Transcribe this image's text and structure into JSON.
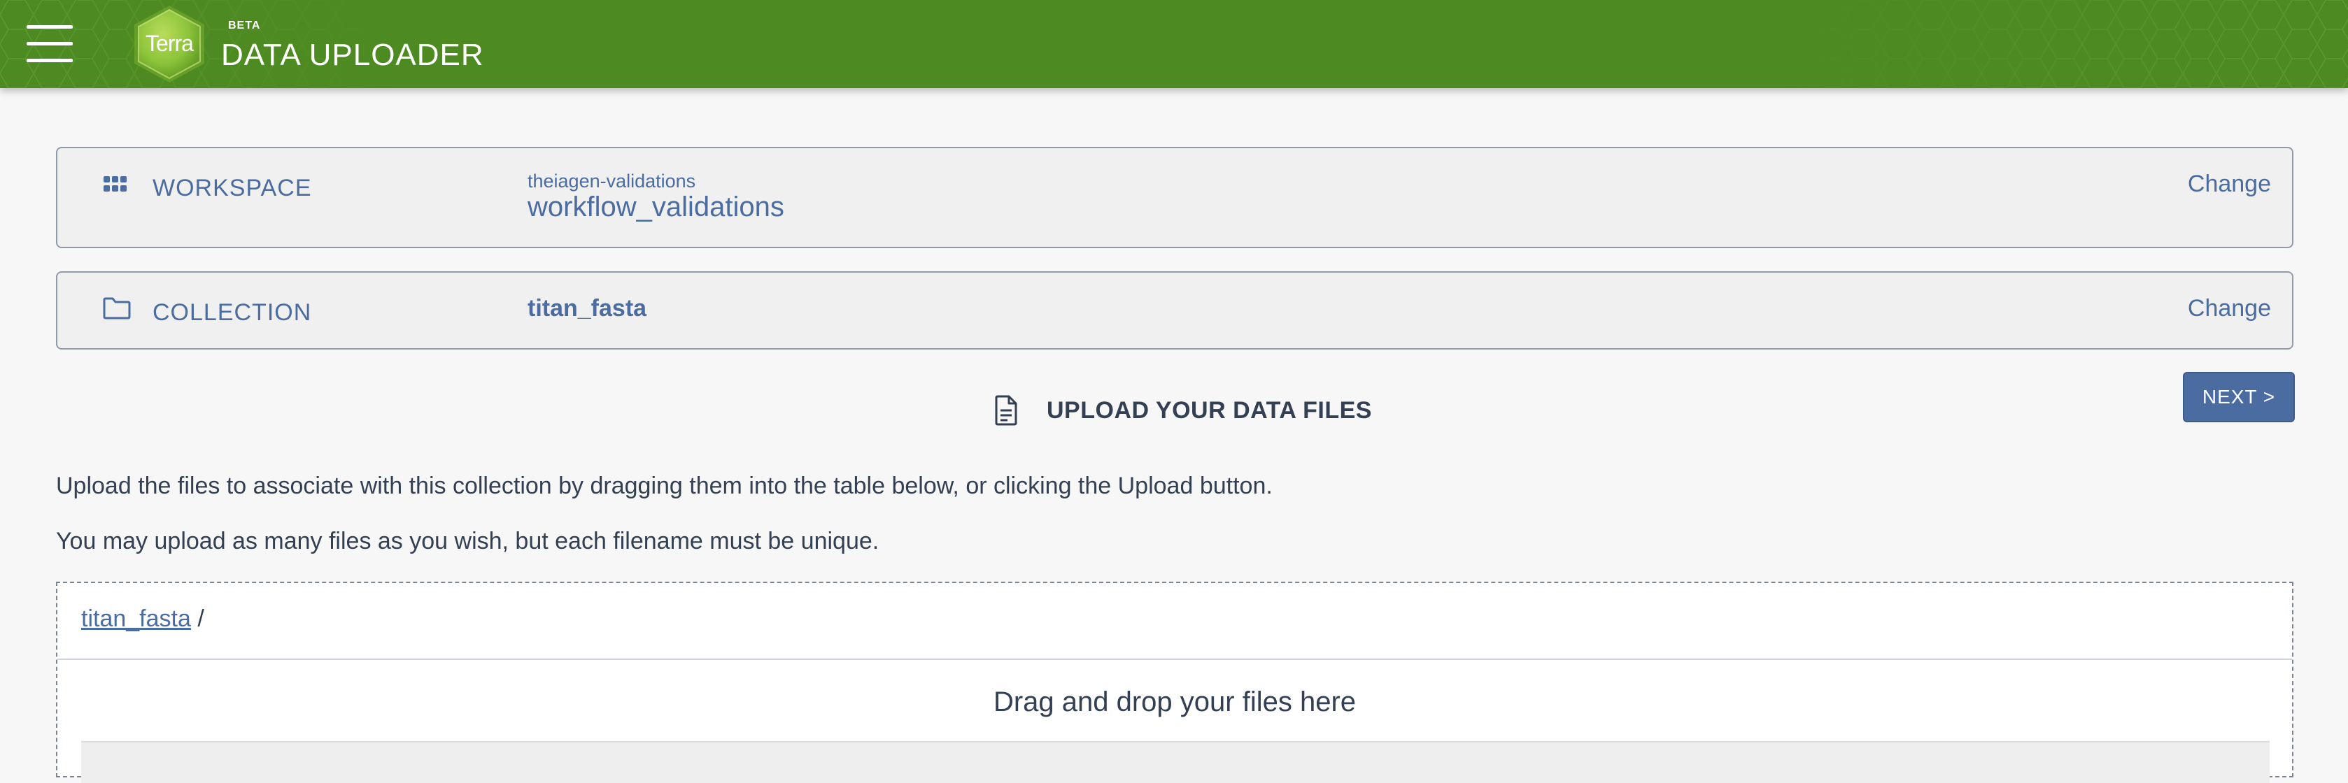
{
  "header": {
    "logo_text": "Terra",
    "beta_label": "BETA",
    "app_title": "DATA UPLOADER"
  },
  "workspace": {
    "label": "WORKSPACE",
    "namespace": "theiagen-validations",
    "name": "workflow_validations",
    "change_label": "Change"
  },
  "collection": {
    "label": "COLLECTION",
    "name": "titan_fasta",
    "change_label": "Change"
  },
  "upload": {
    "heading": "UPLOAD YOUR DATA FILES",
    "next_label": "NEXT >",
    "instruction_1": "Upload the files to associate with this collection by dragging them into the table below, or clicking the Upload button.",
    "instruction_2": "You may upload as many files as you wish, but each filename must be unique."
  },
  "dropzone": {
    "breadcrumb_link": "titan_fasta",
    "breadcrumb_sep": " /",
    "drop_text": "Drag and drop your files here"
  },
  "colors": {
    "header_green": "#4d8a22",
    "accent_blue": "#4a6ca0",
    "text_dark": "#333f52"
  },
  "icons": {
    "menu": "hamburger-menu-icon",
    "workspace": "grid-dots-icon",
    "collection": "folder-icon",
    "upload": "document-icon"
  }
}
